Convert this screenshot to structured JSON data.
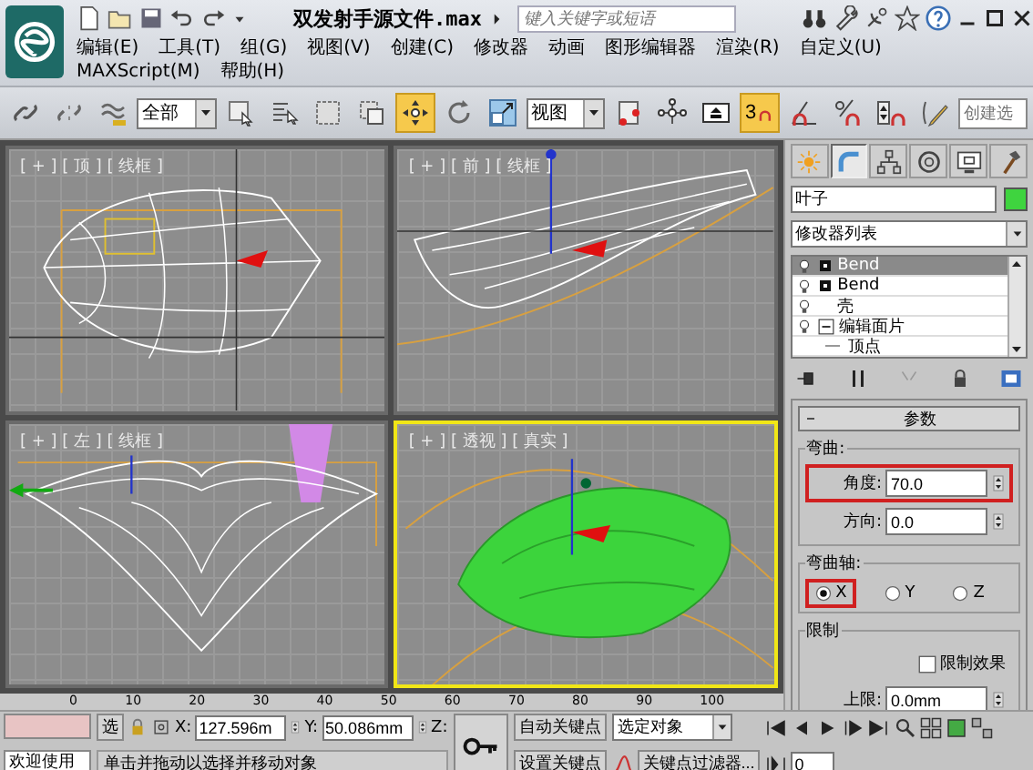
{
  "title_bar": {
    "title": "双发射手源文件.max",
    "search": {
      "placeholder": "键入关键字或短语"
    }
  },
  "menu": [
    "编辑(E)",
    "工具(T)",
    "组(G)",
    "视图(V)",
    "创建(C)",
    "修改器",
    "动画",
    "图形编辑器",
    "渲染(R)",
    "自定义(U)",
    "MAXScript(M)",
    "帮助(H)"
  ],
  "toolbar": [
    {
      "kind": "link",
      "selected": false
    },
    {
      "kind": "unlink",
      "selected": false
    },
    {
      "kind": "bind",
      "selected": false
    },
    {
      "kind": "dropdown",
      "value": "全部"
    },
    {
      "kind": "select",
      "selected": false
    },
    {
      "kind": "select-by-name",
      "selected": false
    },
    {
      "kind": "rect-region",
      "selected": false
    },
    {
      "kind": "window-crossing",
      "selected": false
    },
    {
      "kind": "move",
      "selected": true
    },
    {
      "kind": "rotate",
      "selected": false
    },
    {
      "kind": "scale",
      "selected": false
    },
    {
      "kind": "dropdown",
      "value": "视图"
    },
    {
      "kind": "pivot",
      "selected": false
    },
    {
      "kind": "manipulate",
      "selected": false
    },
    {
      "kind": "keyboard",
      "selected": false
    },
    {
      "kind": "snap",
      "selected": true,
      "label": "3"
    },
    {
      "kind": "angle-snap",
      "selected": false
    },
    {
      "kind": "percent-snap",
      "selected": false
    },
    {
      "kind": "spinner-snap",
      "selected": false
    },
    {
      "kind": "edit-named",
      "selected": false
    },
    {
      "kind": "field",
      "placeholder": "创建选"
    }
  ],
  "viewports": [
    {
      "label": "[ + ] [ 顶 ] [ 线框 ]",
      "kind": "top",
      "selected": false
    },
    {
      "label": "[ + ] [ 前 ] [ 线框 ]",
      "kind": "front",
      "selected": false
    },
    {
      "label": "[ + ] [ 左 ] [ 线框 ]",
      "kind": "left",
      "selected": false
    },
    {
      "label": "[ + ] [ 透视 ] [ 真实 ]",
      "kind": "perspective",
      "selected": true
    }
  ],
  "command_panel": {
    "tabs": [
      {
        "kind": "create",
        "selected": false
      },
      {
        "kind": "modify",
        "selected": true
      },
      {
        "kind": "hierarchy",
        "selected": false
      },
      {
        "kind": "motion",
        "selected": false
      },
      {
        "kind": "display",
        "selected": false
      },
      {
        "kind": "utilities",
        "selected": false
      }
    ],
    "object": {
      "name": "叶子",
      "color": "#3fd43f"
    },
    "modifier_list": "修改器列表",
    "stack": [
      {
        "label": "Bend",
        "kind": "modifier",
        "selected": true
      },
      {
        "label": "Bend",
        "kind": "modifier",
        "selected": false
      },
      {
        "label": "壳",
        "kind": "plain",
        "selected": false
      },
      {
        "label": "编辑面片",
        "kind": "object",
        "selected": false,
        "expanded": true,
        "children": [
          {
            "label": "顶点",
            "kind": "sub-object",
            "selected": false
          }
        ]
      }
    ],
    "rollout": {
      "title": "参数",
      "expanded": true,
      "bend": {
        "title": "弯曲:",
        "fields": [
          {
            "label": "角度:",
            "value": "70.0",
            "highlighted": true
          },
          {
            "label": "方向:",
            "value": "0.0",
            "highlighted": false
          }
        ]
      },
      "axis": {
        "title": "弯曲轴:",
        "options": [
          {
            "label": "X",
            "selected": true,
            "highlighted": true
          },
          {
            "label": "Y",
            "selected": false,
            "highlighted": false
          },
          {
            "label": "Z",
            "selected": false,
            "highlighted": false
          }
        ]
      },
      "limits": {
        "title": "限制",
        "effect": {
          "label": "限制效果",
          "checked": false
        },
        "fields": [
          {
            "label": "上限:",
            "value": "0.0mm"
          }
        ]
      }
    }
  },
  "timeline": {
    "ticks": [
      "0",
      "10",
      "20",
      "30",
      "40",
      "50",
      "60",
      "70",
      "80",
      "90",
      "100"
    ]
  },
  "status_bar": {
    "prompt": "欢迎使用",
    "status_text": "单击并拖动以选择并移动对象",
    "selection_label": "选",
    "x": {
      "label": "X:",
      "value": "127.596m"
    },
    "y": {
      "label": "Y:",
      "value": "50.086mm"
    },
    "z": {
      "label": "Z:"
    },
    "auto_key": "自动关键点",
    "set_key": "设置关键点",
    "key_mode": "选定对象",
    "key_filters": "关键点过滤器...",
    "current_frame": "0"
  }
}
